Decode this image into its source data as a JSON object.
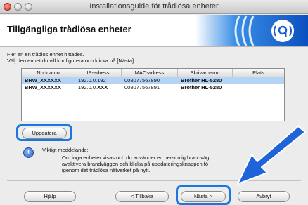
{
  "window": {
    "title": "Installationsguide för trådlösa enheter"
  },
  "banner": {
    "title": "Tillgängliga trådlösa enheter"
  },
  "instructions": [
    "Fler än en trådlös enhet hittades.",
    "Välj den enhet du vill konfigurera och klicka på [Nästa]."
  ],
  "table": {
    "headers": [
      "Nodnamn",
      "IP-adress",
      "MAC-adress",
      "Skrivarnamn",
      "Plats"
    ],
    "rows": [
      {
        "node": "BRW_XXXXXX",
        "ip": "192.0.0.192",
        "mac": "008077567890",
        "printer": "Brother HL-5280",
        "location": "",
        "selected": true
      },
      {
        "node": "BRW_XXXXXX",
        "ip": "192.0.0.",
        "ip_suffix": "XXX",
        "mac": "008077567891",
        "printer": "Brother HL-5280",
        "location": "",
        "selected": false
      }
    ]
  },
  "buttons": {
    "refresh": "Uppdatera",
    "help": "Hjälp",
    "back": "< Tillbaka",
    "next": "Nästa >",
    "cancel": "Avbryt"
  },
  "notice": {
    "icon": "!",
    "heading": "Viktigt meddelande:",
    "lines": [
      "Om inga enheter visas och du använder en personlig brandväg",
      "avaktivera brandväggen och klicka på uppdateringsknappen fö",
      "igenom det trådlösa nätverket på nytt."
    ]
  },
  "colors": {
    "highlight": "#1a77e0",
    "selection": "#b5d3f5",
    "arrow": "#1e64d8"
  }
}
